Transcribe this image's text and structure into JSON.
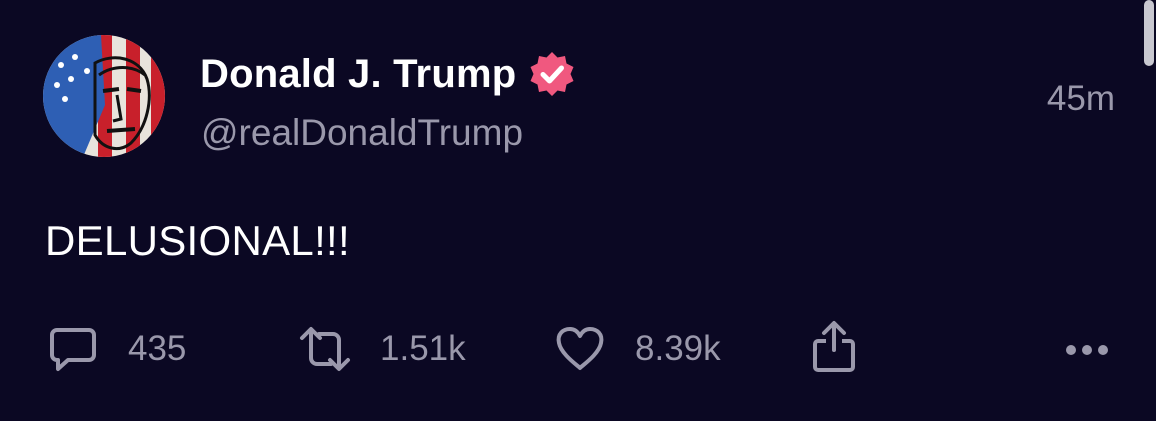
{
  "post": {
    "author": {
      "display_name": "Donald J. Trump",
      "handle": "@realDonaldTrump",
      "verified": true
    },
    "timestamp": "45m",
    "text": "DELUSIONAL!!!",
    "actions": {
      "replies": "435",
      "reposts": "1.51k",
      "likes": "8.39k"
    }
  },
  "icons": [
    "avatar",
    "verified-badge-icon",
    "reply-icon",
    "repost-icon",
    "like-icon",
    "share-icon",
    "more-options-icon"
  ],
  "colors": {
    "background": "#0b0823",
    "primary_text": "#ffffff",
    "secondary_text": "#9a98ab",
    "verified_badge": "#f0587f"
  }
}
